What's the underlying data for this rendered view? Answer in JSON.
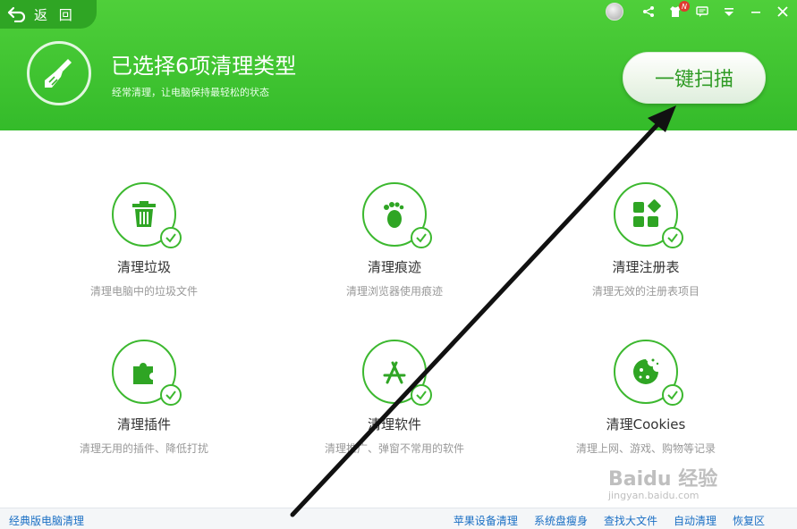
{
  "header": {
    "back_label": "返 回",
    "title": "已选择6项清理类型",
    "subtitle": "经常清理，让电脑保持最轻松的状态",
    "scan_button": "一键扫描",
    "notification_badge": "N"
  },
  "categories": [
    {
      "title": "清理垃圾",
      "desc": "清理电脑中的垃圾文件",
      "icon": "trash-icon"
    },
    {
      "title": "清理痕迹",
      "desc": "清理浏览器使用痕迹",
      "icon": "footprint-icon"
    },
    {
      "title": "清理注册表",
      "desc": "清理无效的注册表项目",
      "icon": "registry-blocks-icon"
    },
    {
      "title": "清理插件",
      "desc": "清理无用的插件、降低打扰",
      "icon": "puzzle-icon"
    },
    {
      "title": "清理软件",
      "desc": "清理推广、弹窗不常用的软件",
      "icon": "app-store-icon"
    },
    {
      "title": "清理Cookies",
      "desc": "清理上网、游戏、购物等记录",
      "icon": "cookie-icon"
    }
  ],
  "footer": {
    "left_link": "经典版电脑清理",
    "links": [
      "苹果设备清理",
      "系统盘瘦身",
      "查找大文件",
      "自动清理",
      "恢复区"
    ]
  },
  "watermark": {
    "brand": "Baidu 经验",
    "url": "jingyan.baidu.com"
  },
  "colors": {
    "accent": "#3cb82f",
    "header_green": "#34bb2a",
    "link_blue": "#1a6fc4"
  }
}
